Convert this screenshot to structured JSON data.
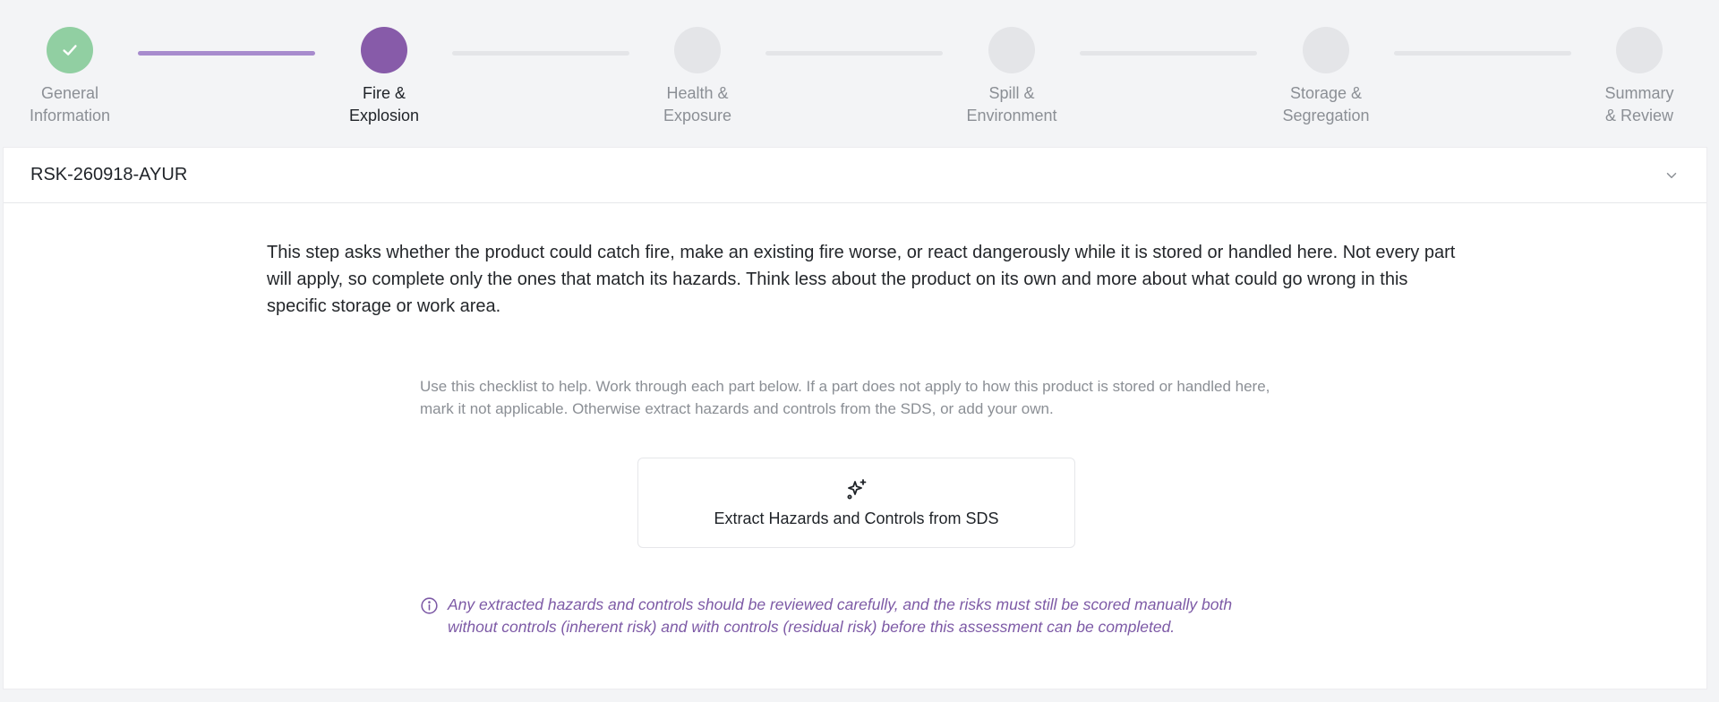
{
  "stepper": {
    "steps": [
      {
        "label": "General\nInformation",
        "state": "done"
      },
      {
        "label": "Fire &\nExplosion",
        "state": "current"
      },
      {
        "label": "Health &\nExposure",
        "state": "todo"
      },
      {
        "label": "Spill &\nEnvironment",
        "state": "todo"
      },
      {
        "label": "Storage &\nSegregation",
        "state": "todo"
      },
      {
        "label": "Summary\n& Review",
        "state": "todo"
      }
    ]
  },
  "card": {
    "reference": "RSK-260918-AYUR",
    "intro": "This step asks whether the product could catch fire, make an existing fire worse, or react dangerously while it is stored or handled here. Not every part will apply, so complete only the ones that match its hazards. Think less about the product on its own and more about what could go wrong in this specific storage or work area.",
    "helper": "Use this checklist to help. Work through each part below. If a part does not apply to how this product is stored or handled here, mark it not applicable. Otherwise extract hazards and controls from the SDS, or add your own.",
    "extract_button_label": "Extract Hazards and Controls from SDS",
    "notice": "Any extracted hazards and controls should be reviewed carefully, and the risks must still be scored manually both without controls (inherent risk) and with controls (residual risk) before this assessment can be completed."
  },
  "colors": {
    "accent": "#875ba9",
    "accent_light": "#a78bcd",
    "done": "#91cfa2",
    "pending": "#e4e5e8",
    "notice_text": "#7d5aa6"
  },
  "icons": {
    "done_step": "check-icon",
    "collapse": "chevron-down-icon",
    "extract": "sparkles-icon",
    "notice": "info-icon"
  }
}
